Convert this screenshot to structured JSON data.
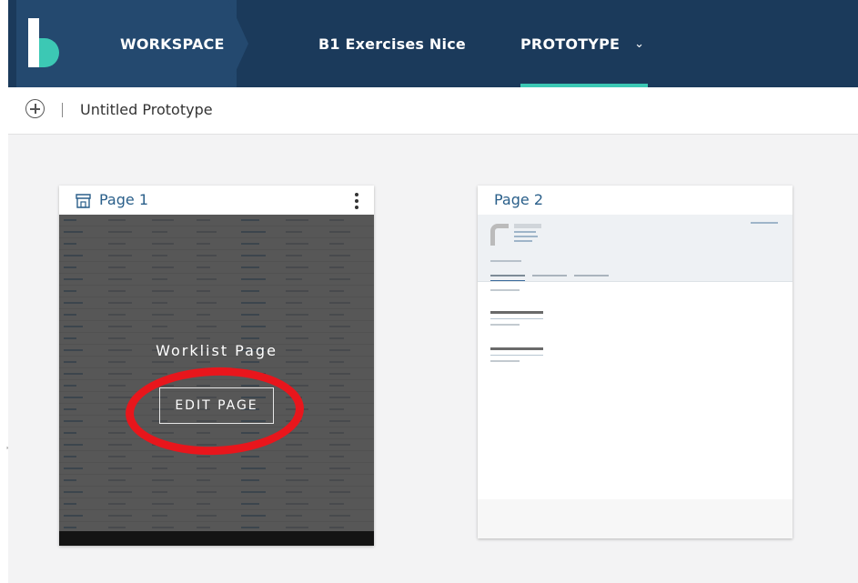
{
  "nav": {
    "workspace": "WORKSPACE",
    "project": "B1 Exercises Nice",
    "prototype": "PROTOTYPE",
    "active_color": "#3cc8b4",
    "bar_color": "#1b3a5b"
  },
  "toolbar": {
    "title": "Untitled Prototype"
  },
  "pages": [
    {
      "title": "Page 1",
      "icon": "storefront-icon",
      "overlay_label": "Worklist Page",
      "edit_label": "EDIT PAGE"
    },
    {
      "title": "Page 2"
    }
  ],
  "stray": "’"
}
